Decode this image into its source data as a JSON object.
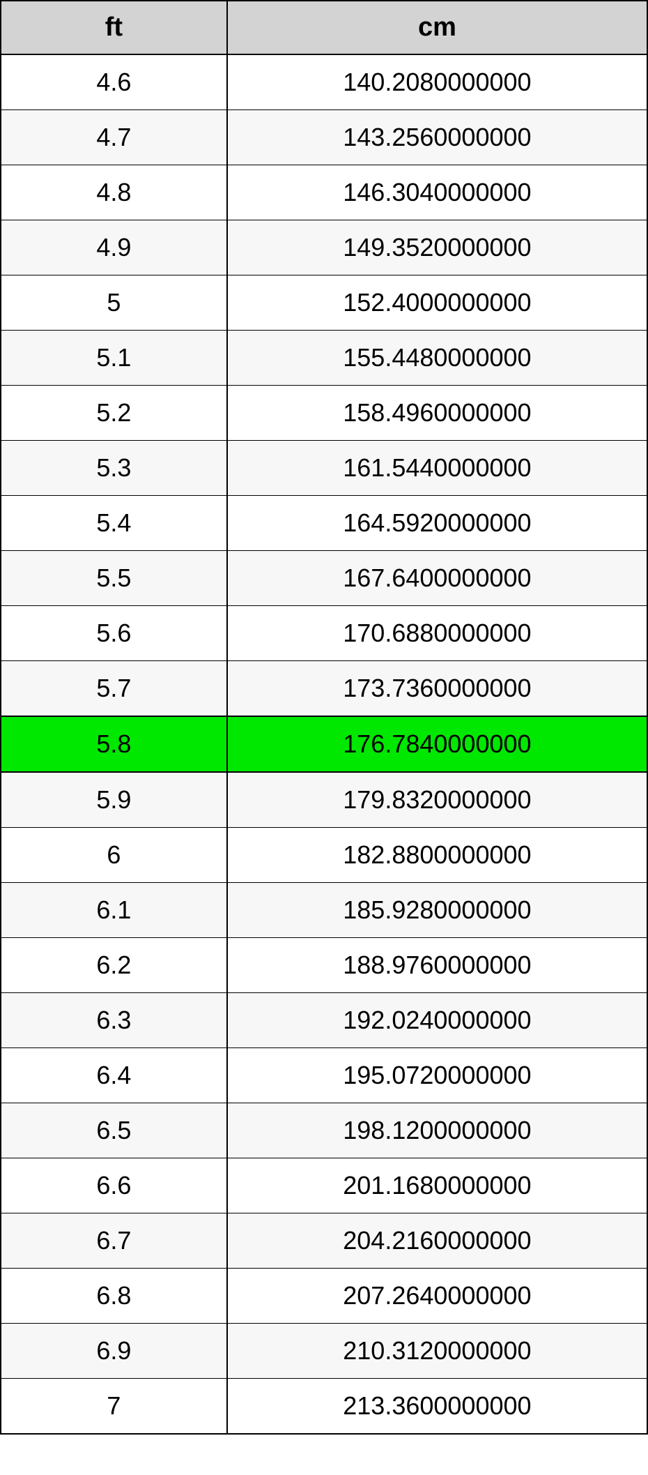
{
  "table": {
    "headers": {
      "col1": "ft",
      "col2": "cm"
    },
    "rows": [
      {
        "ft": "4.6",
        "cm": "140.2080000000",
        "highlighted": false
      },
      {
        "ft": "4.7",
        "cm": "143.2560000000",
        "highlighted": false
      },
      {
        "ft": "4.8",
        "cm": "146.3040000000",
        "highlighted": false
      },
      {
        "ft": "4.9",
        "cm": "149.3520000000",
        "highlighted": false
      },
      {
        "ft": "5",
        "cm": "152.4000000000",
        "highlighted": false
      },
      {
        "ft": "5.1",
        "cm": "155.4480000000",
        "highlighted": false
      },
      {
        "ft": "5.2",
        "cm": "158.4960000000",
        "highlighted": false
      },
      {
        "ft": "5.3",
        "cm": "161.5440000000",
        "highlighted": false
      },
      {
        "ft": "5.4",
        "cm": "164.5920000000",
        "highlighted": false
      },
      {
        "ft": "5.5",
        "cm": "167.6400000000",
        "highlighted": false
      },
      {
        "ft": "5.6",
        "cm": "170.6880000000",
        "highlighted": false
      },
      {
        "ft": "5.7",
        "cm": "173.7360000000",
        "highlighted": false
      },
      {
        "ft": "5.8",
        "cm": "176.7840000000",
        "highlighted": true
      },
      {
        "ft": "5.9",
        "cm": "179.8320000000",
        "highlighted": false
      },
      {
        "ft": "6",
        "cm": "182.8800000000",
        "highlighted": false
      },
      {
        "ft": "6.1",
        "cm": "185.9280000000",
        "highlighted": false
      },
      {
        "ft": "6.2",
        "cm": "188.9760000000",
        "highlighted": false
      },
      {
        "ft": "6.3",
        "cm": "192.0240000000",
        "highlighted": false
      },
      {
        "ft": "6.4",
        "cm": "195.0720000000",
        "highlighted": false
      },
      {
        "ft": "6.5",
        "cm": "198.1200000000",
        "highlighted": false
      },
      {
        "ft": "6.6",
        "cm": "201.1680000000",
        "highlighted": false
      },
      {
        "ft": "6.7",
        "cm": "204.2160000000",
        "highlighted": false
      },
      {
        "ft": "6.8",
        "cm": "207.2640000000",
        "highlighted": false
      },
      {
        "ft": "6.9",
        "cm": "210.3120000000",
        "highlighted": false
      },
      {
        "ft": "7",
        "cm": "213.3600000000",
        "highlighted": false
      }
    ]
  }
}
